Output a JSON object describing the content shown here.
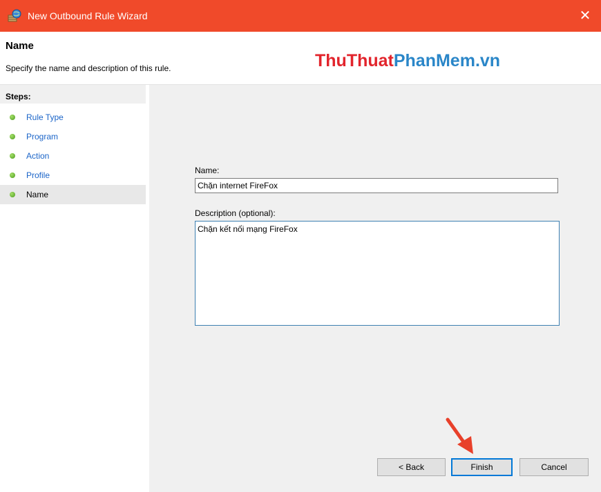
{
  "window": {
    "title": "New Outbound Rule Wizard",
    "close_glyph": "✕",
    "titlebar_color": "#f04a2a"
  },
  "header": {
    "title": "Name",
    "subtitle": "Specify the name and description of this rule."
  },
  "watermark": {
    "part1": "ThuThuat",
    "part2": "PhanMem.vn",
    "color1": "#e2242c",
    "color2": "#2a86c8"
  },
  "steps": {
    "heading": "Steps:",
    "items": [
      {
        "label": "Rule Type",
        "active": false
      },
      {
        "label": "Program",
        "active": false
      },
      {
        "label": "Action",
        "active": false
      },
      {
        "label": "Profile",
        "active": false
      },
      {
        "label": "Name",
        "active": true
      }
    ]
  },
  "form": {
    "name_label": "Name:",
    "name_value": "Chặn internet FireFox",
    "description_label": "Description (optional):",
    "description_value": "Chặn kết nối mạng FireFox"
  },
  "buttons": {
    "back": "< Back",
    "finish": "Finish",
    "cancel": "Cancel"
  },
  "annotation": {
    "arrow_color": "#e8402a",
    "icon": "arrow-down-right-icon"
  }
}
